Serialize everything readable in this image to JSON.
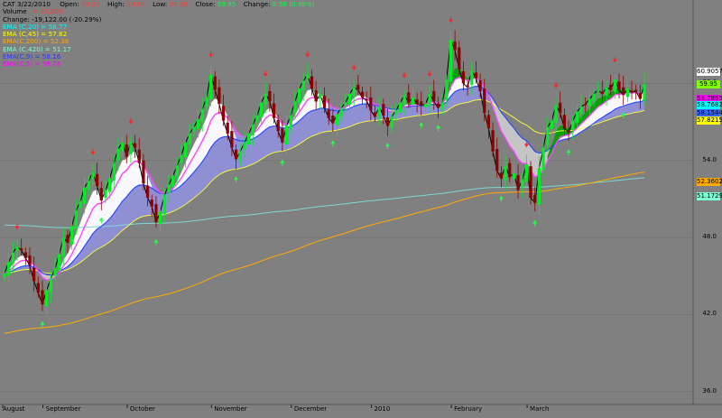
{
  "info": {
    "symbol": "CAT 3/22/2010",
    "open_label": "Open:",
    "open_value": "59.35",
    "high_label": "High:",
    "high_value": "59.95",
    "low_label": "Low:",
    "low_value": "58.39",
    "close_label": "Close:",
    "close_value": "59.95",
    "change_label": "Change:",
    "change_value": "0.58 (0.98%)",
    "volume_label": "Volume",
    "volume_value": "= 75,226",
    "vol_change": "Change:  -19,122.00  (-20.29%)",
    "ind": [
      {
        "text": "EMA (C,20) = 58.77",
        "color": "#00ffff"
      },
      {
        "text": "EMA (C,45) = 57.82",
        "color": "#ffff00"
      },
      {
        "text": "EMA(C,200) = 52.36",
        "color": "#ffaa00"
      },
      {
        "text": "EMA (C,420) = 51.17",
        "color": "#7fffd4"
      },
      {
        "text": "EMA(C,9) = 58.16",
        "color": "#3333ff"
      },
      {
        "text": "EMA(C,5) = 58.78",
        "color": "#ff00ff"
      }
    ]
  },
  "y_axis": {
    "ticks": [
      "60.0",
      "54.0",
      "48.0",
      "42.0",
      "36.0"
    ],
    "range": [
      35.0,
      66.5
    ]
  },
  "x_axis": {
    "labels": [
      "August",
      "September",
      "October",
      "November",
      "December",
      "2010",
      "February",
      "March"
    ]
  },
  "price_labels": [
    {
      "text": "60.9057",
      "value": 60.9057,
      "bg": "#ffffff"
    },
    {
      "text": "59.95",
      "value": 59.95,
      "bg": "#7fff00"
    },
    {
      "text": "58.7895",
      "value": 58.7895,
      "bg": "#ff00ff"
    },
    {
      "text": "58.7682",
      "value": 58.3,
      "bg": "#00ffff"
    },
    {
      "text": "58.1544",
      "value": 57.7,
      "bg": "#3366ff"
    },
    {
      "text": "57.8215",
      "value": 57.1,
      "bg": "#ffff00"
    },
    {
      "text": "52.3602",
      "value": 52.3602,
      "bg": "#ffaa00"
    },
    {
      "text": "51.1729",
      "value": 51.1729,
      "bg": "#7fffd4"
    }
  ],
  "chart_data": {
    "type": "candlestick",
    "title": "CAT 3/22/2010",
    "y_range": [
      35.0,
      66.5
    ],
    "series": [
      {
        "name": "Close",
        "values": [
          45.2,
          46.1,
          46.8,
          47.3,
          47.0,
          46.4,
          45.8,
          44.6,
          43.7,
          42.8,
          43.9,
          44.8,
          45.6,
          46.7,
          48.0,
          47.6,
          48.9,
          50.1,
          50.8,
          51.9,
          52.4,
          53.1,
          52.0,
          50.9,
          51.7,
          52.6,
          53.8,
          54.9,
          55.4,
          54.3,
          55.5,
          55.0,
          53.8,
          52.2,
          51.1,
          50.4,
          49.2,
          50.0,
          51.3,
          52.1,
          52.8,
          53.6,
          54.4,
          55.4,
          56.1,
          56.6,
          57.2,
          58.0,
          58.9,
          60.7,
          59.5,
          58.4,
          57.1,
          56.1,
          55.0,
          54.1,
          54.7,
          55.4,
          56.1,
          56.8,
          57.5,
          58.5,
          59.2,
          58.6,
          57.3,
          56.3,
          55.4,
          56.7,
          57.5,
          58.6,
          59.6,
          60.2,
          60.7,
          59.6,
          58.6,
          59.2,
          58.1,
          57.3,
          56.9,
          57.6,
          58.1,
          58.5,
          59.2,
          59.7,
          59.5,
          58.9,
          58.7,
          57.9,
          57.4,
          58.2,
          57.5,
          56.7,
          57.4,
          57.9,
          58.5,
          59.1,
          58.5,
          58.9,
          58.4,
          58.3,
          58.4,
          59.2,
          58.6,
          58.1,
          58.5,
          60.3,
          63.4,
          62.6,
          61.1,
          60.0,
          59.7,
          61.0,
          60.4,
          59.4,
          57.7,
          56.5,
          54.7,
          53.2,
          52.6,
          53.6,
          52.7,
          53.0,
          51.7,
          52.5,
          53.7,
          51.1,
          50.7,
          53.4,
          55.0,
          56.6,
          57.1,
          58.3,
          57.7,
          56.5,
          56.2,
          57.1,
          57.8,
          58.2,
          58.4,
          58.8,
          59.2,
          59.5,
          59.2,
          59.7,
          59.5,
          60.3,
          59.5,
          59.1,
          59.6,
          59.3,
          59.4,
          58.8,
          59.95
        ]
      }
    ],
    "indicators": [
      {
        "name": "EMA(C,20)",
        "last": 58.77
      },
      {
        "name": "EMA(C,45)",
        "last": 57.82
      },
      {
        "name": "EMA(C,200)",
        "last": 52.36
      },
      {
        "name": "EMA(C,420)",
        "last": 51.17
      },
      {
        "name": "EMA(C,9)",
        "last": 58.16
      },
      {
        "name": "EMA(C,5)",
        "last": 58.78
      }
    ],
    "grid": true
  }
}
